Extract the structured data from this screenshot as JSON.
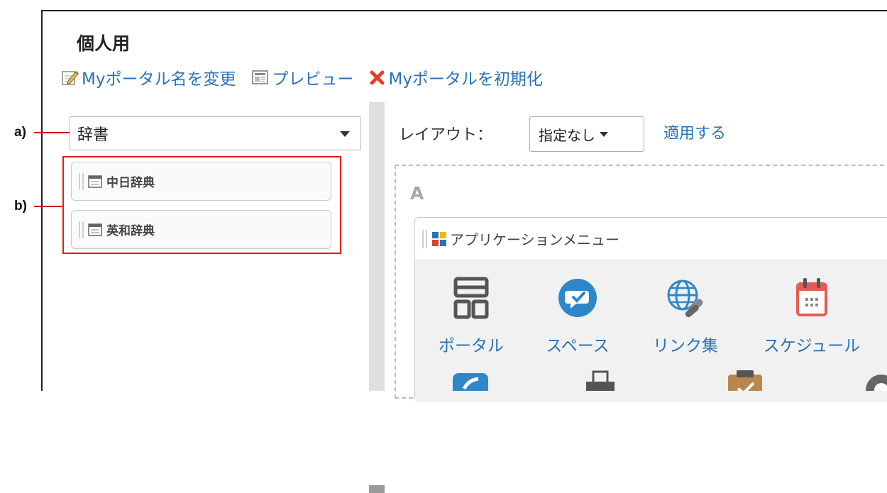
{
  "page": {
    "title": "個人用"
  },
  "actions": [
    {
      "label": "Myポータル名を変更",
      "icon": "edit-icon"
    },
    {
      "label": "プレビュー",
      "icon": "preview-icon"
    },
    {
      "label": "Myポータルを初期化",
      "icon": "reset-x-icon"
    }
  ],
  "callouts": {
    "a": "a)",
    "b": "b)"
  },
  "category_select": {
    "value": "辞書"
  },
  "widgets": [
    {
      "label": "中日辞典"
    },
    {
      "label": "英和辞典"
    }
  ],
  "layout": {
    "label": "レイアウト：",
    "selected": "指定なし",
    "apply": "適用する"
  },
  "zone": {
    "label": "A"
  },
  "app_menu": {
    "title": "アプリケーションメニュー",
    "items": [
      {
        "label": "ポータル",
        "icon": "portal-icon"
      },
      {
        "label": "スペース",
        "icon": "space-icon"
      },
      {
        "label": "リンク集",
        "icon": "link-icon"
      },
      {
        "label": "スケジュール",
        "icon": "calendar-icon"
      }
    ]
  },
  "colors": {
    "link": "#2a72b5",
    "highlight": "#e21b1b",
    "zone_label": "#a7a7a7"
  }
}
